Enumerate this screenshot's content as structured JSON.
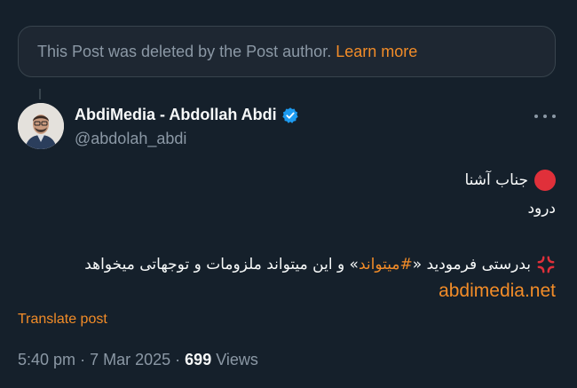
{
  "deleted_notice": {
    "text": "This Post was deleted by the Post author.",
    "learn_more": "Learn more"
  },
  "author": {
    "name": "AbdiMedia - Abdollah Abdi",
    "handle": "@abdolah_abdi",
    "verified": true
  },
  "post": {
    "line1": "جناب آشنا",
    "line2": "درود",
    "line3_start": "بدرستی فرمودید «",
    "hashtag": "#میتواند",
    "line3_end": "» و این میتواند ملزومات و توجهاتی میخواهد",
    "link": "abdimedia.net"
  },
  "translate_label": "Translate post",
  "meta": {
    "time": "5:40 pm",
    "date": "7 Mar 2025",
    "separator": "·",
    "views_count": "699",
    "views_label": "Views"
  },
  "colors": {
    "background": "#15202b",
    "accent": "#f28c28",
    "verified_blue": "#1d9bf0",
    "red_dot": "#e0303a"
  },
  "icons": [
    "verified-badge-icon",
    "more-options-icon",
    "red-circle-icon",
    "anger-symbol-icon"
  ]
}
